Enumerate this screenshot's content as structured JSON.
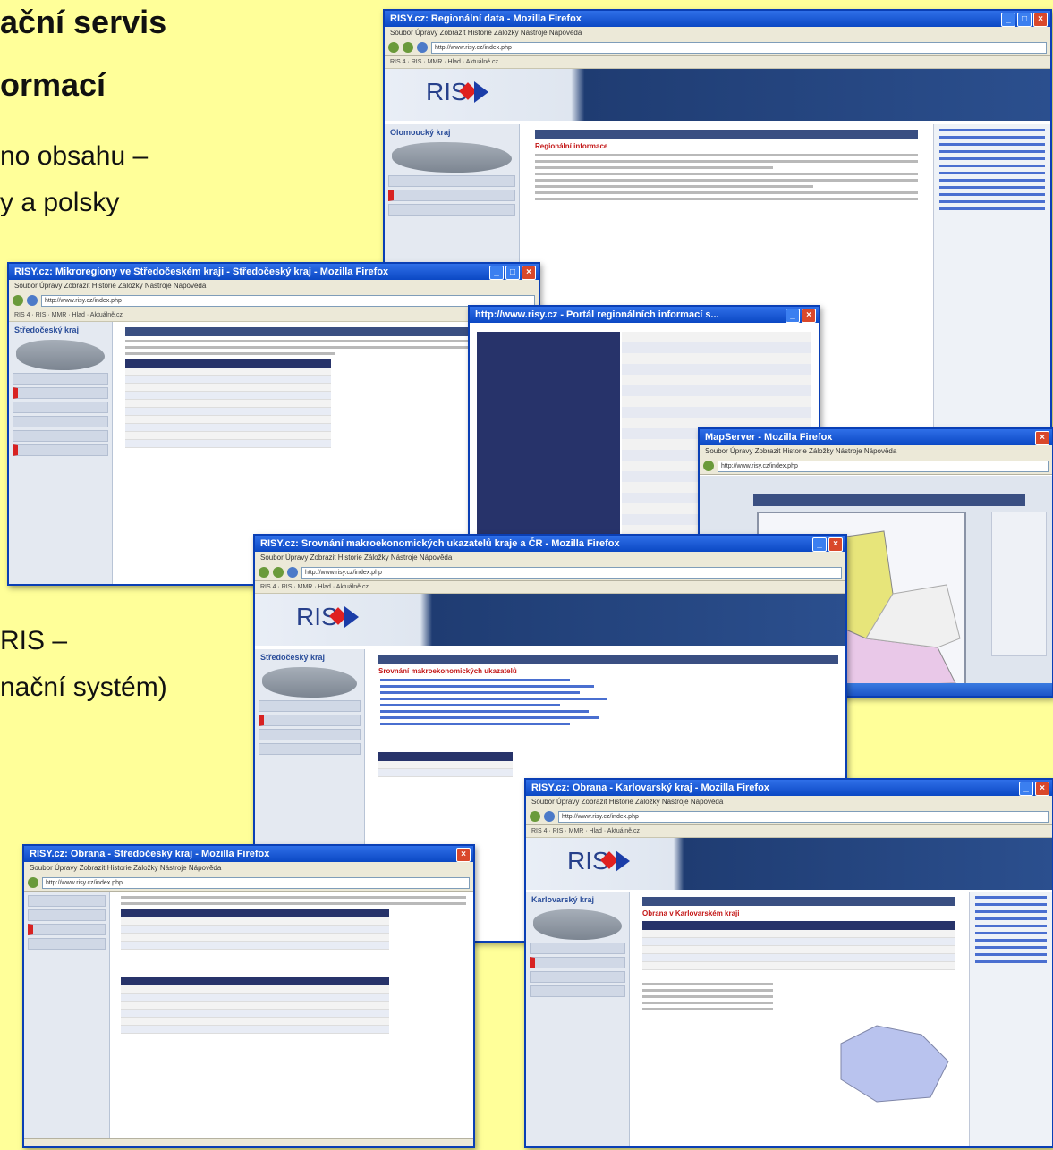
{
  "slide": {
    "heading_line1": "ační servis",
    "heading_line2": "ormací",
    "body_line1": "no obsahu –",
    "body_line2": "y a polsky",
    "body_line3": "RIS –",
    "body_line4": "nační systém)"
  },
  "windows": {
    "w1": {
      "title": "RISY.cz: Regionální data - Mozilla Firefox",
      "region": "Olomoucký kraj",
      "section": "Regionální informace"
    },
    "w2": {
      "title": "RISY.cz: Mikroregiony ve Středočeském kraji - Středočeský kraj - Mozilla Firefox",
      "region": "Středočeský kraj"
    },
    "w3": {
      "title": "http://www.risy.cz - Portál regionálních informací s..."
    },
    "w4": {
      "title": "MapServer - Mozilla Firefox"
    },
    "w5": {
      "title": "RISY.cz: Srovnání makroekonomických ukazatelů kraje a ČR - Mozilla Firefox",
      "region": "Středočeský kraj",
      "section": "Srovnání makroekonomických ukazatelů"
    },
    "w6": {
      "title": "RISY.cz: Obrana - Středočeský kraj - Mozilla Firefox"
    },
    "w7": {
      "title": "RISY.cz: Obrana - Karlovarský kraj - Mozilla Firefox",
      "region": "Karlovarský kraj",
      "section": "Obrana v Karlovarském kraji"
    }
  },
  "logo_text": "RIS",
  "url_text": "http://www.risy.cz/index.php",
  "menu_text": "Soubor  Úpravy  Zobrazit  Historie  Záložky  Nástroje  Nápověda",
  "bookmarks_text": "RIS 4  ·  RIS  ·  MMR  ·  Hlad  ·  Aktuálně.cz",
  "colors": {
    "slide_bg": "#ffff99",
    "title_bar": "#0b48c4",
    "banner": "#2b4f8e",
    "accent_red": "#d82222"
  }
}
